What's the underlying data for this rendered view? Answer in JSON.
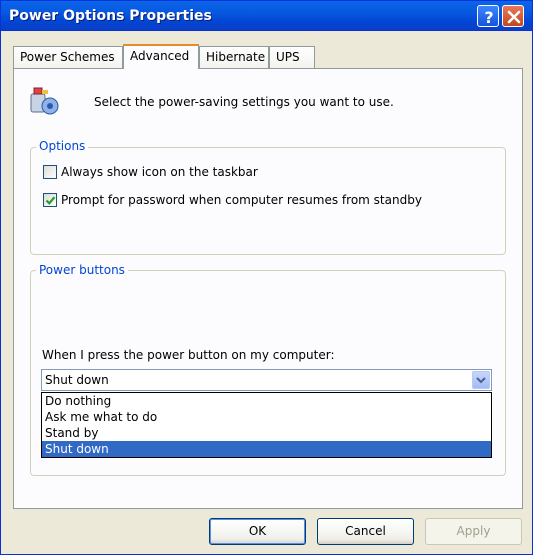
{
  "window": {
    "title": "Power Options Properties"
  },
  "titlebar_buttons": {
    "help_icon": "help-icon",
    "close_icon": "close-icon"
  },
  "tabs": [
    {
      "label": "Power Schemes",
      "active": false
    },
    {
      "label": "Advanced",
      "active": true
    },
    {
      "label": "Hibernate",
      "active": false
    },
    {
      "label": "UPS",
      "active": false
    }
  ],
  "header": {
    "icon": "power-settings-icon",
    "text": "Select the power-saving settings you want to use."
  },
  "options": {
    "group_label": "Options",
    "items": [
      {
        "label": "Always show icon on the taskbar",
        "checked": false
      },
      {
        "label": "Prompt for password when computer resumes from standby",
        "checked": true
      }
    ]
  },
  "power_buttons": {
    "group_label": "Power buttons",
    "prompt": "When I press the power button on my computer:",
    "selected": "Shut down",
    "options": [
      "Do nothing",
      "Ask me what to do",
      "Stand by",
      "Shut down"
    ]
  },
  "footer": {
    "ok": "OK",
    "cancel": "Cancel",
    "apply": "Apply"
  },
  "colors": {
    "titlebar": "#0A66E8",
    "dialog_bg": "#ECE9D8",
    "group_label": "#0046D5",
    "selection": "#316AC5",
    "active_tab_accent": "#E68B2C"
  }
}
